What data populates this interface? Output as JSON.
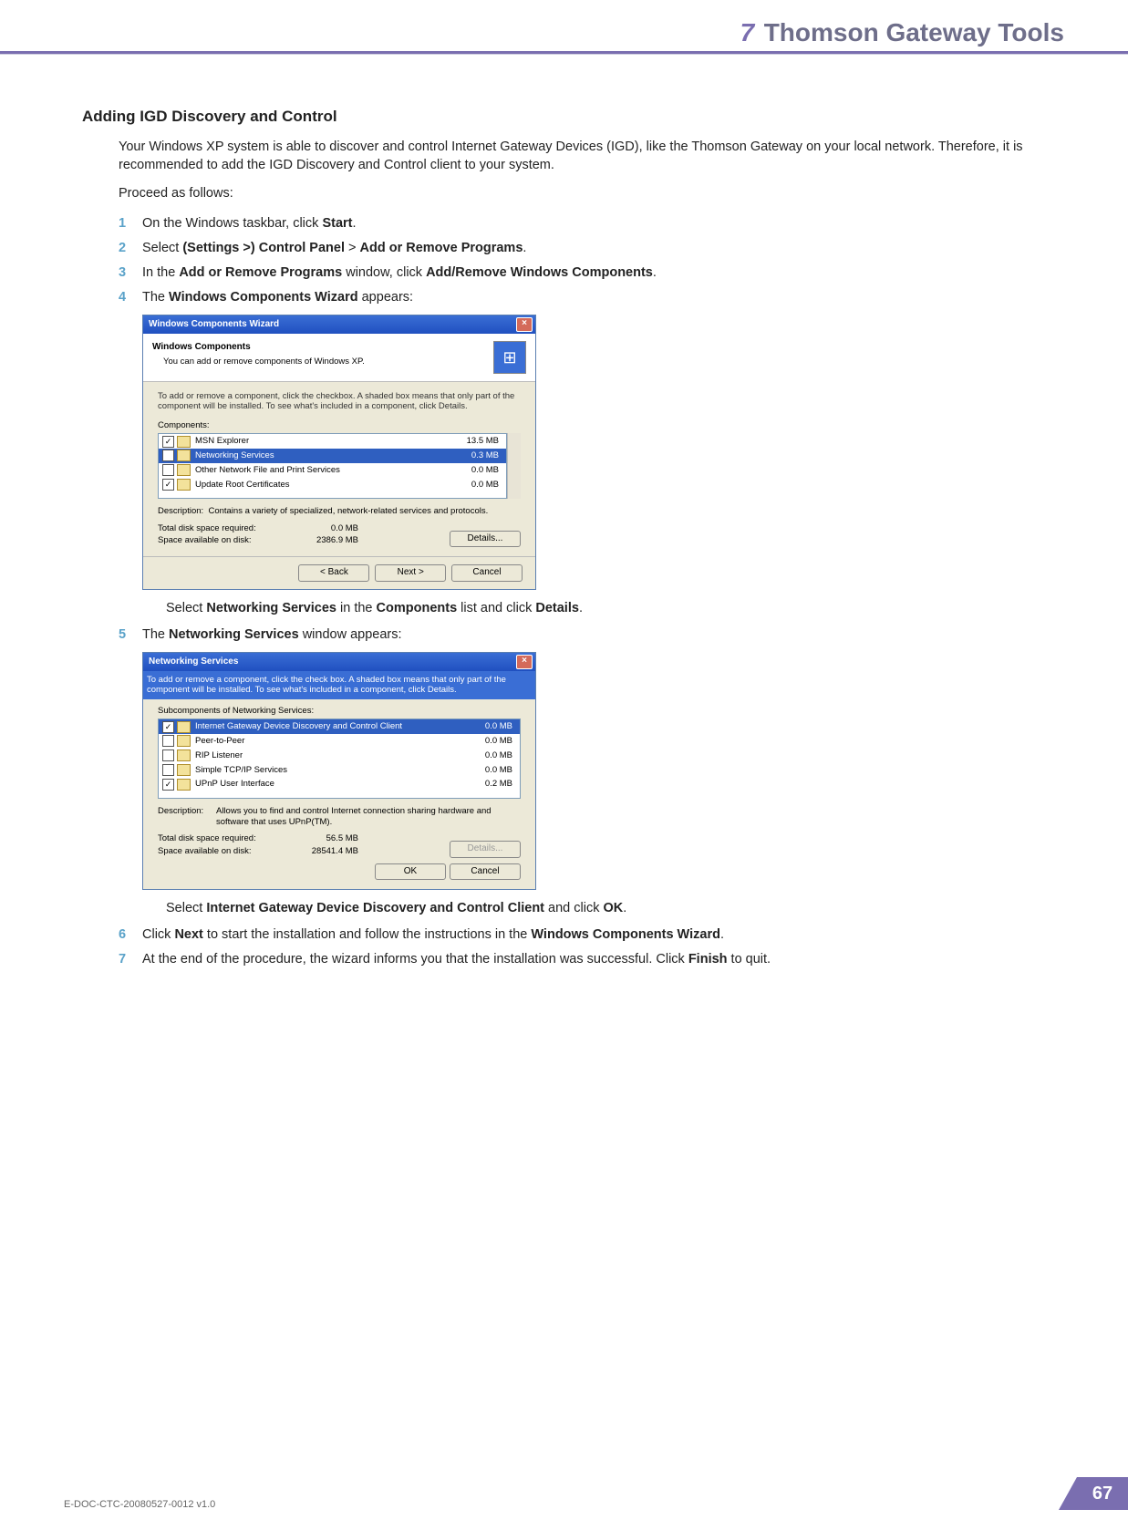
{
  "header": {
    "chapter_num": "7",
    "chapter_title": "Thomson Gateway Tools"
  },
  "section_title": "Adding IGD Discovery and Control",
  "intro1": "Your Windows XP system is able to discover and control Internet Gateway Devices (IGD), like the Thomson Gateway on your local network. Therefore, it is recommended to add the IGD Discovery and Control client to your system.",
  "intro2": "Proceed as follows:",
  "steps": {
    "s1": {
      "num": "1",
      "t_pre": "On the Windows taskbar, click ",
      "t_b1": "Start",
      "t_post": "."
    },
    "s2": {
      "num": "2",
      "t_pre": "Select ",
      "t_b1": "(Settings >) Control Panel",
      "t_mid": " > ",
      "t_b2": "Add or Remove Programs",
      "t_post": "."
    },
    "s3": {
      "num": "3",
      "t_pre": "In the ",
      "t_b1": "Add or Remove Programs",
      "t_mid": " window, click ",
      "t_b2": "Add/Remove Windows Components",
      "t_post": "."
    },
    "s4": {
      "num": "4",
      "t_pre": "The ",
      "t_b1": "Windows Components Wizard",
      "t_post": " appears:"
    },
    "s4_after": {
      "t_pre": "Select ",
      "t_b1": "Networking Services",
      "t_mid": " in the ",
      "t_b2": "Components",
      "t_mid2": " list and click ",
      "t_b3": "Details",
      "t_post": "."
    },
    "s5": {
      "num": "5",
      "t_pre": "The ",
      "t_b1": "Networking Services",
      "t_post": " window appears:"
    },
    "s5_after": {
      "t_pre": "Select ",
      "t_b1": "Internet Gateway Device Discovery and Control Client",
      "t_mid": " and click ",
      "t_b2": "OK",
      "t_post": "."
    },
    "s6": {
      "num": "6",
      "t_pre": "Click ",
      "t_b1": "Next",
      "t_mid": " to start the installation and follow the instructions in the ",
      "t_b2": "Windows Components Wizard",
      "t_post": "."
    },
    "s7": {
      "num": "7",
      "t_pre": "At the end of the procedure, the wizard informs you that the installation was successful. Click ",
      "t_b1": "Finish",
      "t_post": " to quit."
    }
  },
  "wcw": {
    "title": "Windows Components Wizard",
    "head_bold": "Windows Components",
    "head_sub": "You can add or remove components of Windows XP.",
    "instr": "To add or remove a component, click the checkbox. A shaded box means that only part of the component will be installed. To see what's included in a component, click Details.",
    "components_label": "Components:",
    "rows": [
      {
        "checked": true,
        "name": "MSN Explorer",
        "size": "13.5 MB",
        "selected": false
      },
      {
        "checked": false,
        "name": "Networking Services",
        "size": "0.3 MB",
        "selected": true
      },
      {
        "checked": false,
        "name": "Other Network File and Print Services",
        "size": "0.0 MB",
        "selected": false
      },
      {
        "checked": true,
        "name": "Update Root Certificates",
        "size": "0.0 MB",
        "selected": false
      }
    ],
    "desc_label": "Description:",
    "desc_text": "Contains a variety of specialized, network-related services and protocols.",
    "disk_req_label": "Total disk space required:",
    "disk_req_val": "0.0 MB",
    "disk_avail_label": "Space available on disk:",
    "disk_avail_val": "2386.9 MB",
    "btn_details": "Details...",
    "btn_back": "< Back",
    "btn_next": "Next >",
    "btn_cancel": "Cancel"
  },
  "ns": {
    "title": "Networking Services",
    "instr": "To add or remove a component, click the check box. A shaded box means that only part of the component will be installed. To see what's included in a component, click Details.",
    "sub_label": "Subcomponents of Networking Services:",
    "rows": [
      {
        "checked": true,
        "name": "Internet Gateway Device Discovery and Control Client",
        "size": "0.0 MB",
        "selected": true
      },
      {
        "checked": false,
        "name": "Peer-to-Peer",
        "size": "0.0 MB",
        "selected": false
      },
      {
        "checked": false,
        "name": "RIP Listener",
        "size": "0.0 MB",
        "selected": false
      },
      {
        "checked": false,
        "name": "Simple TCP/IP Services",
        "size": "0.0 MB",
        "selected": false
      },
      {
        "checked": true,
        "name": "UPnP User Interface",
        "size": "0.2 MB",
        "selected": false
      }
    ],
    "desc_label": "Description:",
    "desc_text": "Allows you to find and control Internet connection sharing hardware and software that uses UPnP(TM).",
    "disk_req_label": "Total disk space required:",
    "disk_req_val": "56.5 MB",
    "disk_avail_label": "Space available on disk:",
    "disk_avail_val": "28541.4 MB",
    "btn_details": "Details...",
    "btn_ok": "OK",
    "btn_cancel": "Cancel"
  },
  "footer": {
    "docid": "E-DOC-CTC-20080527-0012 v1.0",
    "page": "67"
  }
}
